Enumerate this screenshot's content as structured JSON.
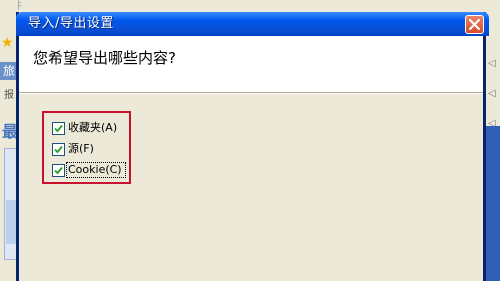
{
  "background": {
    "menu_fragment": "文件",
    "tab_label": "旅",
    "side_label": "报",
    "big_text": "最"
  },
  "dialog": {
    "title": "导入/导出设置",
    "question": "您希望导出哪些内容?",
    "options": [
      {
        "label": "收藏夹(A)",
        "checked": true
      },
      {
        "label": "源(F)",
        "checked": true
      },
      {
        "label": "Cookie(C)",
        "checked": true
      }
    ]
  },
  "colors": {
    "titlebar": "#0058ee",
    "highlight_box": "#c8102e",
    "dialog_face": "#ece9d8"
  }
}
